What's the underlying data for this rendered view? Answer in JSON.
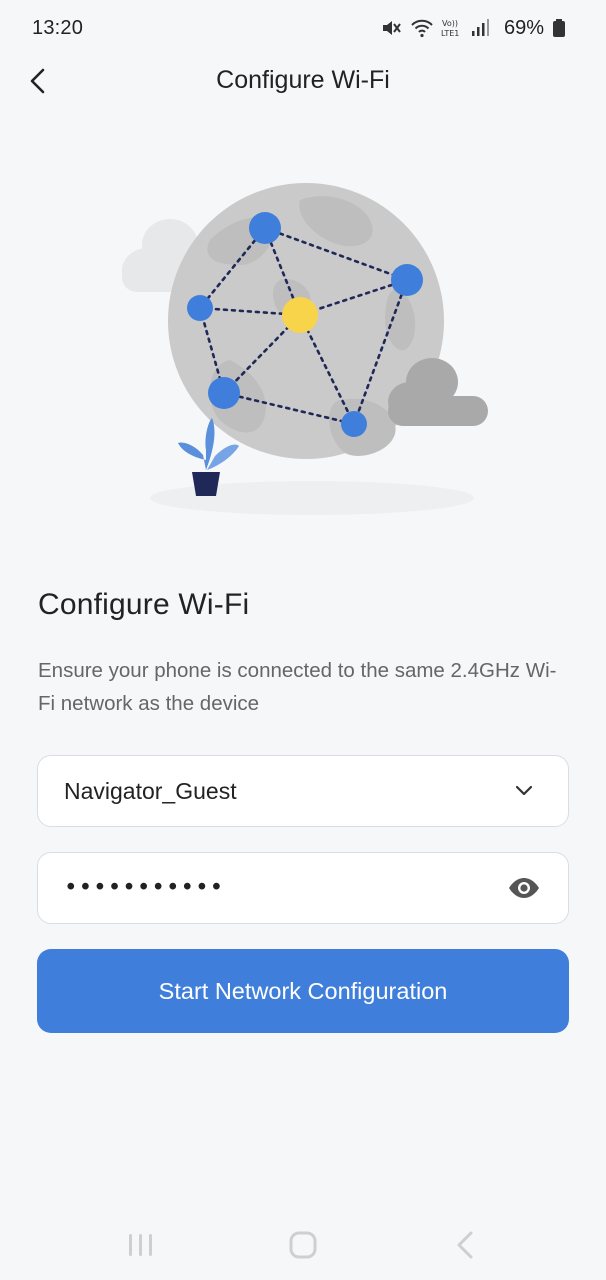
{
  "status_bar": {
    "time": "13:20",
    "battery_percent": "69%",
    "icons": [
      "mute-icon",
      "wifi-icon",
      "volte-lte-icon",
      "signal-icon",
      "battery-icon"
    ]
  },
  "header": {
    "title": "Configure Wi-Fi",
    "back_icon": "chevron-left-icon"
  },
  "illustration": {
    "description_icon": "network-globe-illustration",
    "colors": {
      "node": "#3f7fdb",
      "center_node": "#f7d44a",
      "globe": "#c9c9c9",
      "cloud_dark": "#a9a9a9",
      "plant_pot": "#1f2857",
      "leaf": "#5a8fdc"
    }
  },
  "main": {
    "title": "Configure Wi-Fi",
    "description": "Ensure your phone is connected to the same 2.4GHz Wi-Fi network as the device",
    "ssid_field": {
      "value": "Navigator_Guest",
      "icon": "chevron-down-icon"
    },
    "password_field": {
      "value": "•••••••••••",
      "icon": "eye-icon"
    },
    "submit_label": "Start Network Configuration",
    "accent_color": "#3f7fdb"
  },
  "system_nav": {
    "icons": [
      "recent-apps-icon",
      "home-icon",
      "back-icon"
    ]
  }
}
